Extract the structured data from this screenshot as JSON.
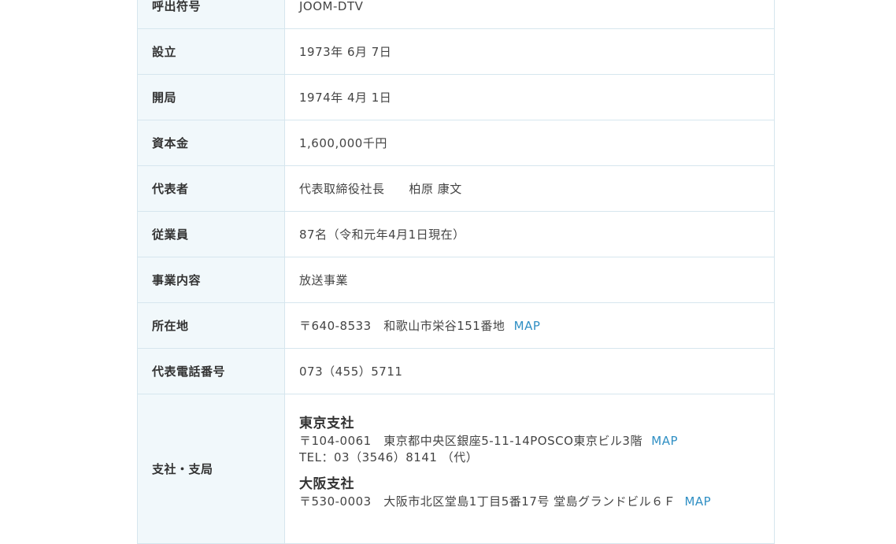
{
  "rows": [
    {
      "label": "呼出符号",
      "value": "JOOM-DTV"
    },
    {
      "label": "設立",
      "value": "1973年 6月 7日"
    },
    {
      "label": "開局",
      "value": "1974年 4月 1日"
    },
    {
      "label": "資本金",
      "value": "1,600,000千円"
    },
    {
      "label": "代表者",
      "value": "代表取締役社長　　柏原 康文"
    },
    {
      "label": "従業員",
      "value": "87名（令和元年4月1日現在）"
    },
    {
      "label": "事業内容",
      "value": "放送事業"
    },
    {
      "label": "所在地",
      "value": "〒640-8533　和歌山市栄谷151番地",
      "link": "MAP"
    },
    {
      "label": "代表電話番号",
      "value": "073（455）5711"
    }
  ],
  "branches": {
    "label": "支社・支局",
    "items": [
      {
        "name": "東京支社",
        "address": "〒104-0061　東京都中央区銀座5-11-14POSCO東京ビル3階",
        "link": "MAP",
        "tel": "TEL：03（3546）8141 （代）"
      },
      {
        "name": "大阪支社",
        "address": "〒530-0003　大阪市北区堂島1丁目5番17号 堂島グランドビル６Ｆ",
        "link": "MAP"
      }
    ]
  },
  "colors": {
    "label_bg": "#f1f8fb",
    "border": "#d6e6ee",
    "link": "#2f8fc4"
  }
}
